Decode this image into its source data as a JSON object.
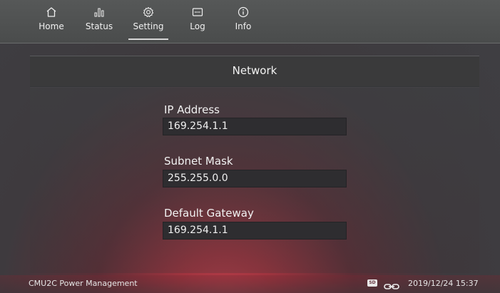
{
  "nav": {
    "home": {
      "label": "Home",
      "icon": "home-icon"
    },
    "status": {
      "label": "Status",
      "icon": "bar-chart-icon"
    },
    "setting": {
      "label": "Setting",
      "icon": "gear-icon",
      "active": true
    },
    "log": {
      "label": "Log",
      "icon": "log-icon"
    },
    "info": {
      "label": "Info",
      "icon": "info-icon"
    }
  },
  "panel": {
    "title": "Network"
  },
  "fields": {
    "ip": {
      "label": "IP Address",
      "value": "169.254.1.1"
    },
    "subnet": {
      "label": "Subnet Mask",
      "value": "255.255.0.0"
    },
    "gateway": {
      "label": "Default Gateway",
      "value": "169.254.1.1"
    }
  },
  "statusbar": {
    "app_name": "CMU2C Power Management",
    "sd_label": "SD",
    "datetime": "2019/12/24 15:37"
  },
  "colors": {
    "background": "#3f3f43",
    "glow": "#c4434f",
    "panel_header": "#3a3a3b",
    "field_box": "#2e2d30"
  }
}
